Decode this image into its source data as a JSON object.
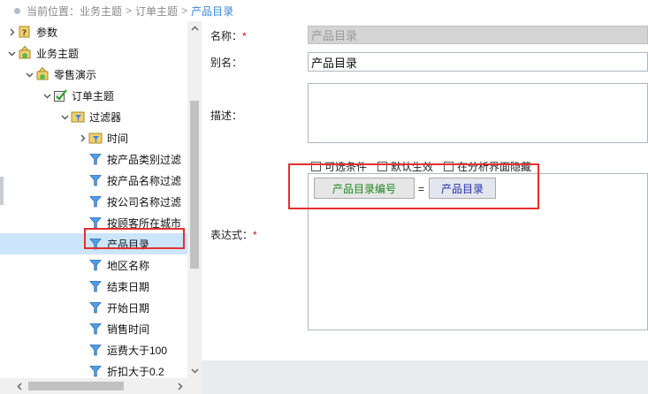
{
  "breadcrumb": {
    "prefix": "当前位置：",
    "items": [
      "业务主题",
      "订单主题"
    ],
    "current": "产品目录",
    "separator": ">"
  },
  "tree": {
    "items": [
      {
        "label": "参数",
        "icon": "parameter-folder-icon",
        "arrow": "right",
        "depth": 0
      },
      {
        "label": "业务主题",
        "icon": "business-theme-icon",
        "arrow": "down",
        "depth": 0
      },
      {
        "label": "零售演示",
        "icon": "business-theme-icon",
        "arrow": "down",
        "depth": 1
      },
      {
        "label": "订单主题",
        "icon": "order-theme-icon",
        "arrow": "down",
        "depth": 2
      },
      {
        "label": "过滤器",
        "icon": "filter-folder-icon",
        "arrow": "down",
        "depth": 3
      },
      {
        "label": "时间",
        "icon": "filter-folder-icon",
        "arrow": "right",
        "depth": 4
      },
      {
        "label": "按产品类别过滤",
        "icon": "filter-icon",
        "arrow": "",
        "depth": 4
      },
      {
        "label": "按产品名称过滤",
        "icon": "filter-icon",
        "arrow": "",
        "depth": 4
      },
      {
        "label": "按公司名称过滤",
        "icon": "filter-icon",
        "arrow": "",
        "depth": 4
      },
      {
        "label": "按顾客所在城市",
        "icon": "filter-icon",
        "arrow": "",
        "depth": 4
      },
      {
        "label": "产品目录",
        "icon": "filter-icon",
        "arrow": "",
        "depth": 4,
        "selected": true
      },
      {
        "label": "地区名称",
        "icon": "filter-icon",
        "arrow": "",
        "depth": 4
      },
      {
        "label": "结束日期",
        "icon": "filter-icon",
        "arrow": "",
        "depth": 4
      },
      {
        "label": "开始日期",
        "icon": "filter-icon",
        "arrow": "",
        "depth": 4
      },
      {
        "label": "销售时间",
        "icon": "filter-icon",
        "arrow": "",
        "depth": 4
      },
      {
        "label": "运费大于100",
        "icon": "filter-icon",
        "arrow": "",
        "depth": 4
      },
      {
        "label": "折扣大于0.2",
        "icon": "filter-icon",
        "arrow": "",
        "depth": 4
      }
    ]
  },
  "form": {
    "name_label": "名称：",
    "name_required": "*",
    "name_value": "产品目录",
    "alias_label": "别名：",
    "alias_value": "产品目录",
    "desc_label": "描述：",
    "desc_value": "",
    "expr_label": "表达式：",
    "expr_required": "*"
  },
  "options": {
    "optional_label": "可选条件",
    "default_label": "默认生效",
    "hidden_label": "在分析界面隐藏"
  },
  "expression": {
    "left": "产品目录编号",
    "operator": "=",
    "right": "产品目录"
  },
  "colors": {
    "accent": "#3b86d6",
    "selection": "#cce5fb",
    "highlight": "#e23030",
    "field_green": "#1a8a1a",
    "param_blue": "#1f2fa8"
  }
}
